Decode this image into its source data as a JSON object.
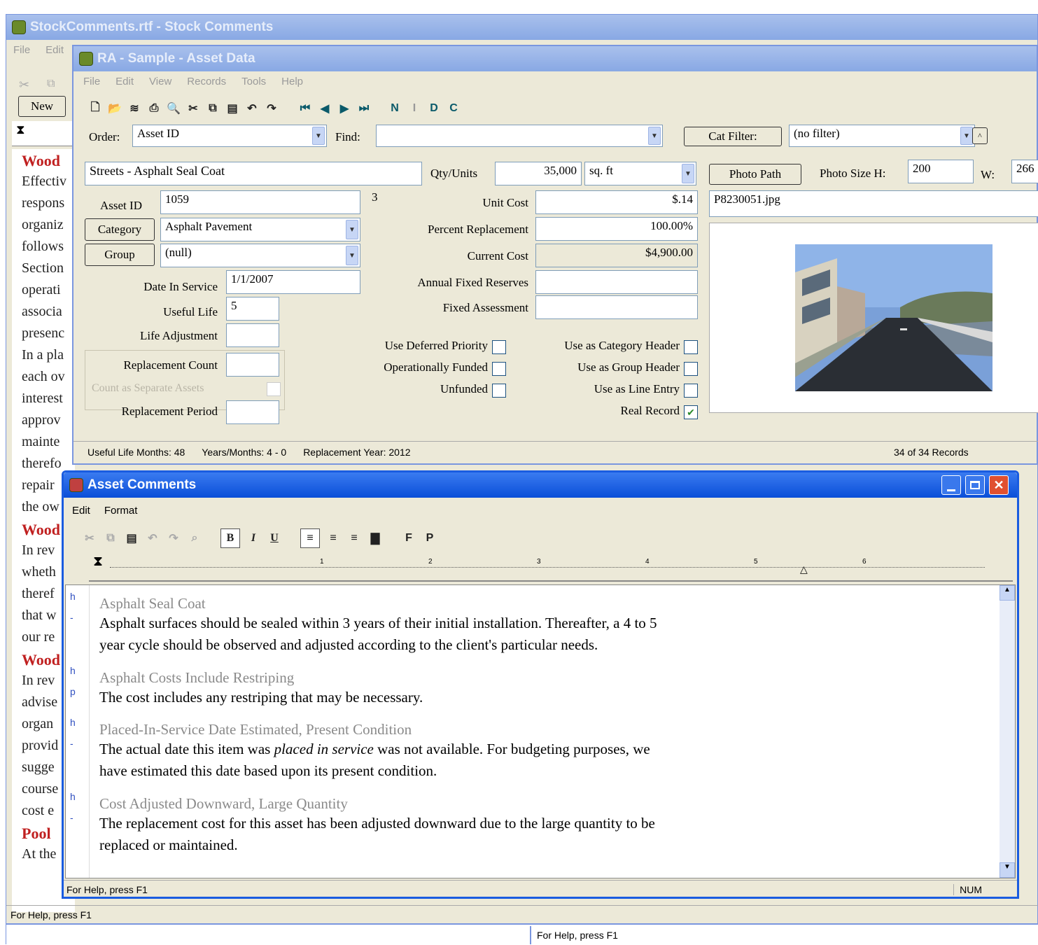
{
  "bg_window": {
    "title": "StockComments.rtf - Stock Comments",
    "menu": [
      "File",
      "Edit"
    ],
    "new_label": "New",
    "text_lines": [
      {
        "t": "Wood",
        "h": true
      },
      {
        "t": "Effectiv"
      },
      {
        "t": "respons"
      },
      {
        "t": "organiz"
      },
      {
        "t": "follows"
      },
      {
        "t": "Section"
      },
      {
        "t": "operati"
      },
      {
        "t": "associa"
      },
      {
        "t": "presenc"
      },
      {
        "t": "In a pla"
      },
      {
        "t": "each ov"
      },
      {
        "t": "interest"
      },
      {
        "t": "approv"
      },
      {
        "t": "mainte"
      },
      {
        "t": "therefo"
      },
      {
        "t": "repair"
      },
      {
        "t": "the ow"
      },
      {
        "t": "Wood",
        "h": true
      },
      {
        "t": "In rev"
      },
      {
        "t": "wheth"
      },
      {
        "t": "theref"
      },
      {
        "t": "that w"
      },
      {
        "t": "our re"
      },
      {
        "t": "Wood",
        "h": true
      },
      {
        "t": "In rev"
      },
      {
        "t": "advise"
      },
      {
        "t": "organ"
      },
      {
        "t": "provid"
      },
      {
        "t": "sugge"
      },
      {
        "t": "course"
      },
      {
        "t": "cost e"
      },
      {
        "t": "Pool",
        "h": true
      },
      {
        "t": "At the"
      }
    ],
    "status_text": "For Help, press F1",
    "bottom_status": "For Help, press F1"
  },
  "asset_window": {
    "title": "RA - Sample - Asset Data",
    "menu": [
      "File",
      "Edit",
      "View",
      "Records",
      "Tools",
      "Help"
    ],
    "order_label": "Order:",
    "order_value": "Asset ID",
    "find_label": "Find:",
    "find_value": "",
    "cat_filter_label": "Cat Filter:",
    "filter_value": "(no filter)",
    "asset_name": "Streets - Asphalt Seal Coat",
    "qty_units_label": "Qty/Units",
    "qty_value": "35,000",
    "unit_value": "sq. ft",
    "photo_path_label": "Photo Path",
    "photo_size_label": "Photo Size H:",
    "photo_h": "200",
    "photo_w_label": "W:",
    "photo_w": "266",
    "photo_file": "P8230051.jpg",
    "asset_id_label": "Asset ID",
    "asset_id": "1059",
    "asset_id_note": "3",
    "category_label": "Category",
    "category_value": "Asphalt Pavement",
    "group_label": "Group",
    "group_value": "(null)",
    "date_label": "Date In Service",
    "date_value": "1/1/2007",
    "useful_life_label": "Useful Life",
    "useful_life_value": "5",
    "life_adj_label": "Life Adjustment",
    "replacement_count_label": "Replacement Count",
    "count_separate_label": "Count as Separate Assets",
    "replacement_period_label": "Replacement Period",
    "unit_cost_label": "Unit Cost",
    "unit_cost": "$.14",
    "pct_repl_label": "Percent Replacement",
    "pct_repl": "100.00%",
    "current_cost_label": "Current Cost",
    "current_cost": "$4,900.00",
    "annual_fixed_label": "Annual Fixed Reserves",
    "fixed_assess_label": "Fixed Assessment",
    "checks_left": [
      {
        "label": "Use Deferred Priority",
        "checked": false
      },
      {
        "label": "Operationally Funded",
        "checked": false
      },
      {
        "label": "Unfunded",
        "checked": false
      }
    ],
    "checks_right": [
      {
        "label": "Use as Category Header",
        "checked": false
      },
      {
        "label": "Use as Group Header",
        "checked": false
      },
      {
        "label": "Use as Line Entry",
        "checked": false
      },
      {
        "label": "Real Record",
        "checked": true
      }
    ],
    "status_life": "Useful Life Months: 48",
    "status_years": "Years/Months: 4 - 0",
    "status_repl_year": "Replacement Year: 2012",
    "status_records": "34 of 34 Records"
  },
  "comments_window": {
    "title": "Asset Comments",
    "menu": [
      "Edit",
      "Format"
    ],
    "format_buttons": [
      "B",
      "I",
      "U",
      "F",
      "P"
    ],
    "ruler_numbers": [
      "1",
      "2",
      "3",
      "4",
      "5",
      "6"
    ],
    "paragraphs": [
      {
        "marker": "h",
        "heading": "Asphalt Seal Coat",
        "marker2": "-",
        "body": [
          "Asphalt surfaces should be sealed within 3 years of their initial installation.  Thereafter, a 4 to 5",
          "year cycle should be observed and adjusted according to the client's particular needs."
        ]
      },
      {
        "marker": "h",
        "heading": "Asphalt Costs Include Restriping",
        "marker2": "p",
        "body": [
          "The cost includes any restriping that may be necessary."
        ]
      },
      {
        "marker": "h",
        "heading": "Placed-In-Service Date Estimated, Present Condition",
        "marker2": "-",
        "body_rich": {
          "pre": "The actual date this item was ",
          "em": "placed in service",
          "post": " was not available.  For budgeting purposes, we"
        },
        "body": [
          "have estimated this date based upon its present condition."
        ]
      },
      {
        "marker": "h",
        "heading": "Cost Adjusted Downward, Large Quantity",
        "marker2": "-",
        "body": [
          "The replacement cost for this asset has been adjusted downward due to the large quantity to be",
          "replaced or maintained."
        ]
      }
    ],
    "status_text": "For Help, press F1",
    "status_num": "NUM"
  }
}
